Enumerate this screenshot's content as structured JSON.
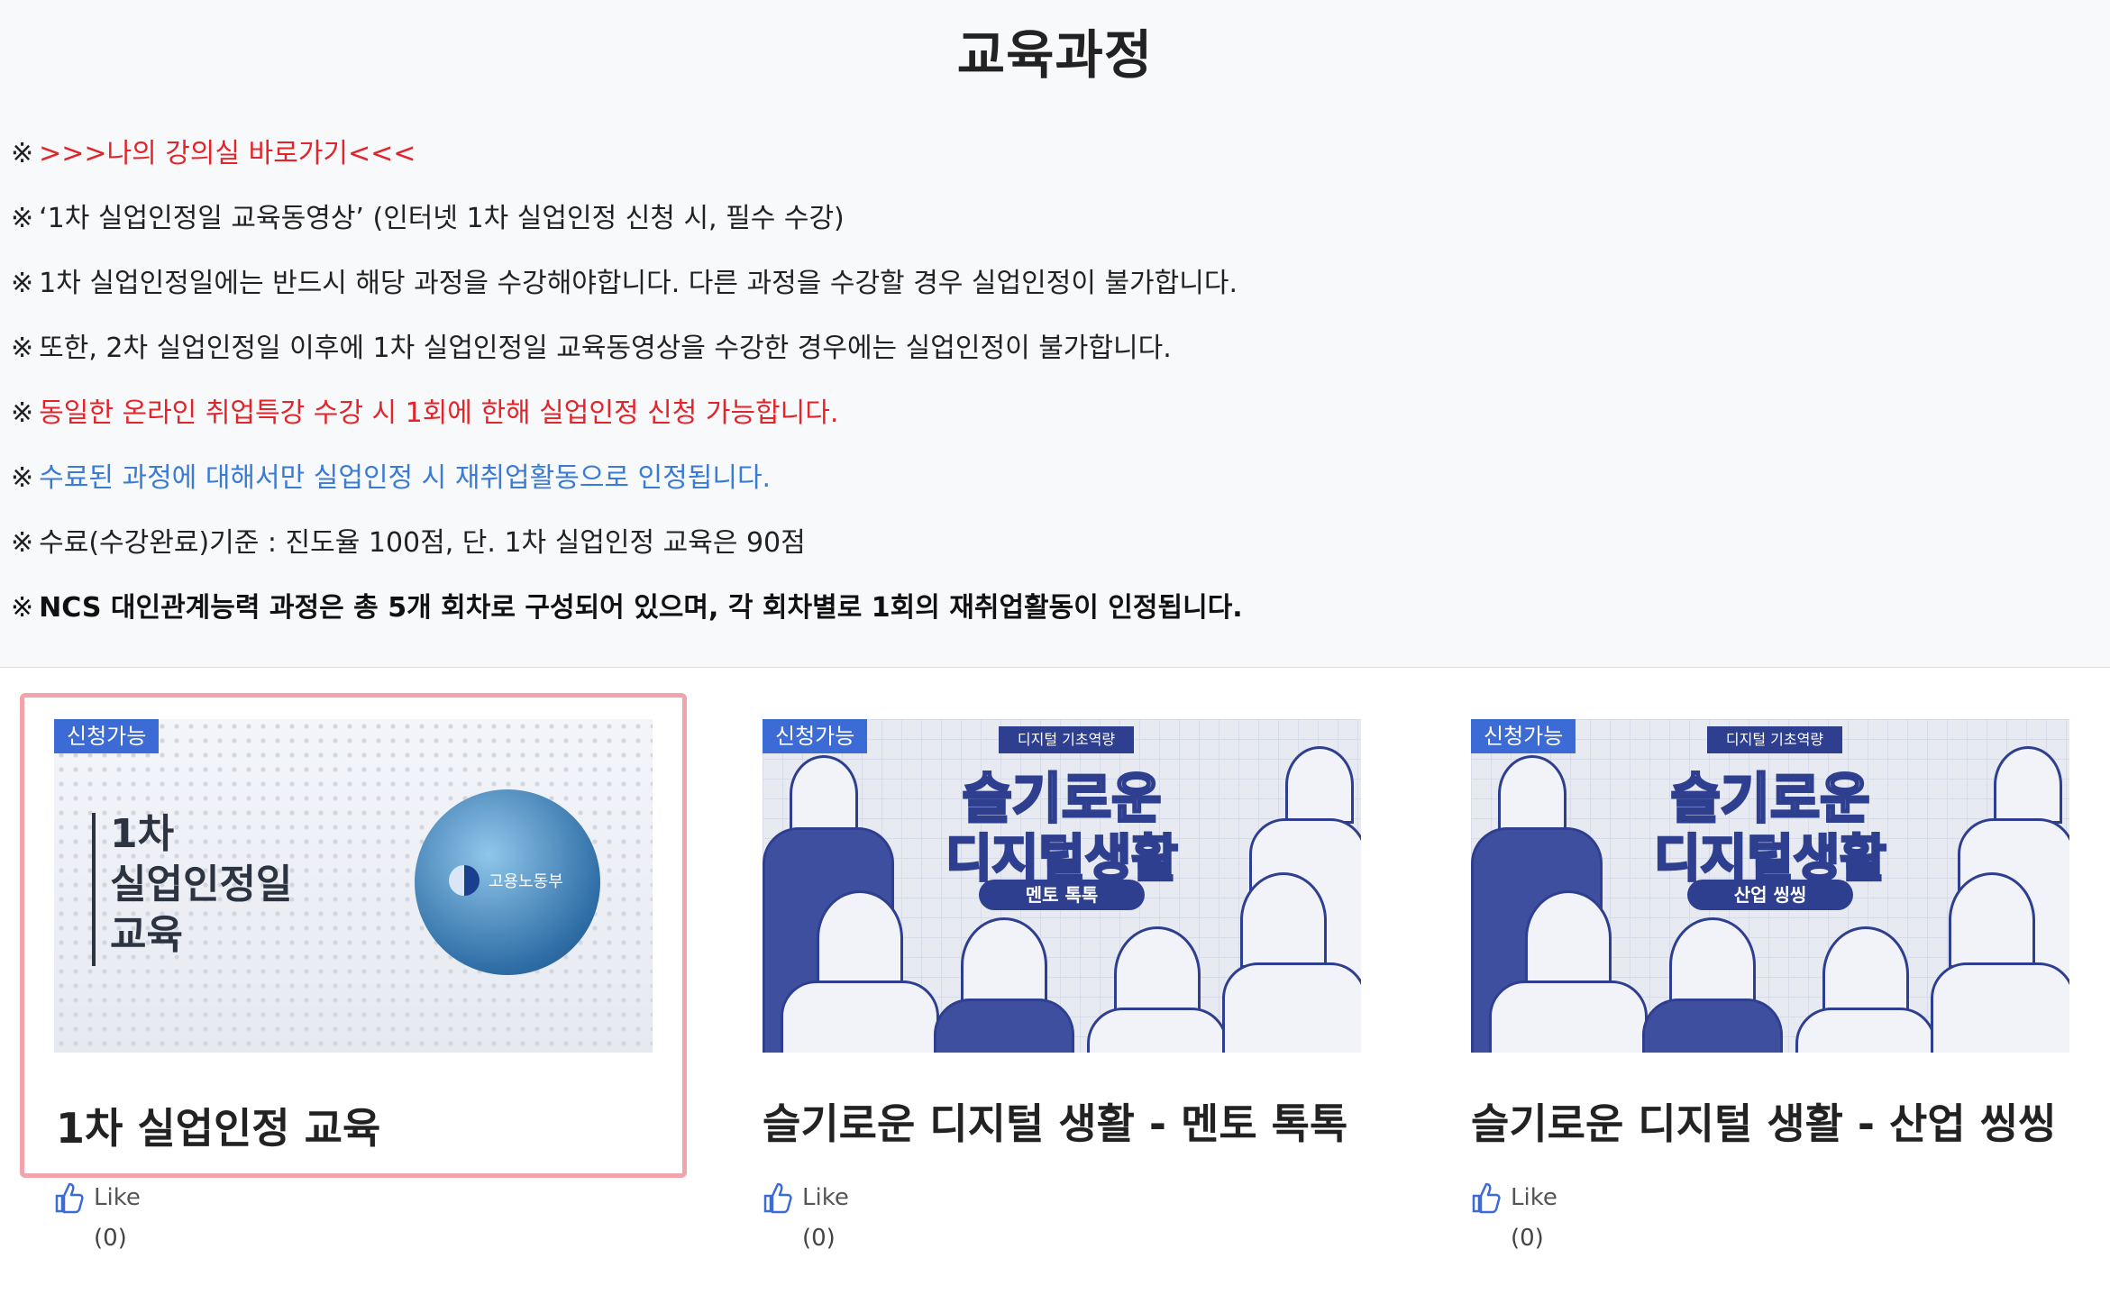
{
  "page": {
    "title": "교육과정"
  },
  "notices": [
    {
      "mark": "※",
      "text": ">>>나의 강의실 바로가기<<<",
      "style": "link"
    },
    {
      "mark": "※",
      "text": "‘1차 실업인정일 교육동영상’ (인터넷 1차 실업인정 신청 시, 필수 수강)",
      "style": "normal"
    },
    {
      "mark": "※",
      "text": "1차 실업인정일에는 반드시 해당 과정을 수강해야합니다. 다른 과정을 수강할 경우 실업인정이 불가합니다.",
      "style": "normal"
    },
    {
      "mark": "※",
      "text": "또한, 2차 실업인정일 이후에 1차 실업인정일 교육동영상을 수강한 경우에는 실업인정이 불가합니다.",
      "style": "normal"
    },
    {
      "mark": "※",
      "text": "동일한 온라인 취업특강 수강 시 1회에 한해 실업인정 신청 가능합니다.",
      "style": "red"
    },
    {
      "mark": "※",
      "text": "수료된 과정에 대해서만 실업인정 시 재취업활동으로 인정됩니다.",
      "style": "blue"
    },
    {
      "mark": "※",
      "text": "수료(수강완료)기준 : 진도율 100점, 단. 1차 실업인정 교육은 90점",
      "style": "normal"
    },
    {
      "mark": "※",
      "text": "NCS 대인관계능력 과정은 총 5개 회차로 구성되어 있으며, 각 회차별로 1회의 재취업활동이 인정됩니다.",
      "style": "bold"
    }
  ],
  "courses": [
    {
      "badge": "신청가능",
      "title": "1차 실업인정 교육",
      "like_label": "Like",
      "like_count": "(0)",
      "thumb": {
        "line1": "1차",
        "line2": "실업인정일",
        "line3": "교육",
        "logo_text": "고용노동부"
      }
    },
    {
      "badge": "신청가능",
      "title": "슬기로운 디지털 생활 - 멘토 톡톡",
      "like_label": "Like",
      "like_count": "(0)",
      "thumb": {
        "ribbon": "디지털 기초역량",
        "big1": "슬기로운",
        "big2": "디지털생활",
        "pill": "멘토 톡톡"
      }
    },
    {
      "badge": "신청가능",
      "title": "슬기로운 디지털 생활 - 산업 씽씽",
      "like_label": "Like",
      "like_count": "(0)",
      "thumb": {
        "ribbon": "디지털 기초역량",
        "big1": "슬기로운",
        "big2": "디지털생활",
        "pill": "산업 씽씽"
      }
    }
  ],
  "colors": {
    "badge": "#3c6bd6",
    "red": "#e3242b",
    "blue": "#3a7bd5",
    "selected_border": "#f2a3ab",
    "like_icon": "#3c6bd6"
  },
  "icons": {
    "like": "thumbs-up-icon"
  }
}
